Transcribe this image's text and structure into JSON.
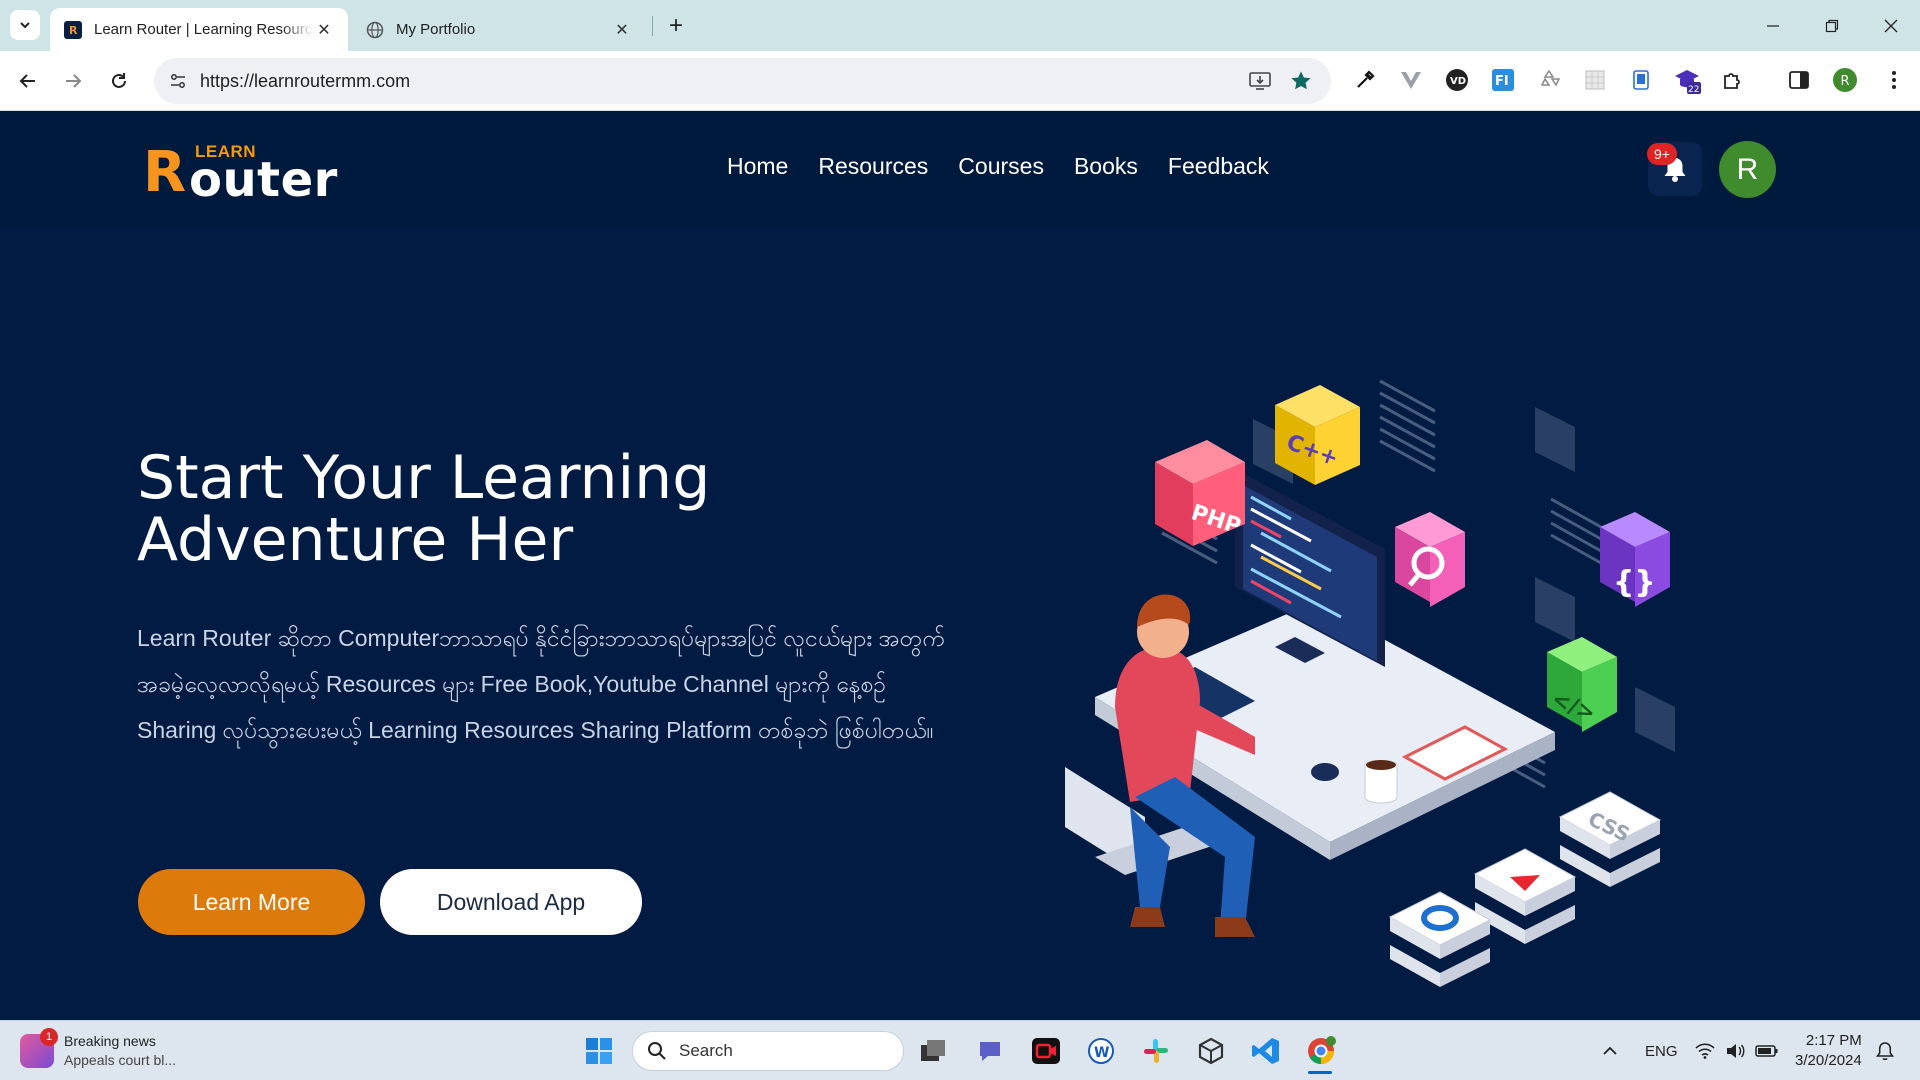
{
  "browser": {
    "tabs": [
      {
        "title": "Learn Router | Learning Resources",
        "active": true
      },
      {
        "title": "My Portfolio",
        "active": false
      }
    ],
    "url": "https://learnroutermm.com",
    "extension_badge": "22",
    "profile_initial": "R"
  },
  "site": {
    "logo_small": "LEARN",
    "logo_r": "R",
    "logo_rest": "outer",
    "nav": [
      "Home",
      "Resources",
      "Courses",
      "Books",
      "Feedback"
    ],
    "notification_badge": "9+",
    "avatar_initial": "R"
  },
  "hero": {
    "title": "Start Your Learning Adventure Her",
    "description": "Learn Router ဆိုတာ Computerဘာသာရပ် နိုင်ငံခြားဘာသာရပ်များအပြင် လူငယ်များ အတွက် အခမဲ့လေ့လာလိုရမယ့် Resources များ Free Book,Youtube Channel များကို နေ့စဉ် Sharing လုပ်သွားပေးမယ့် Learning Resources Sharing Platform တစ်ခုဘဲ ဖြစ်ပါတယ်။",
    "primary_button": "Learn More",
    "secondary_button": "Download App",
    "illustration_labels": [
      "PHP",
      "C++",
      "CSS"
    ]
  },
  "taskbar": {
    "news_badge": "1",
    "news_title": "Breaking news",
    "news_subtitle": "Appeals court bl...",
    "search_label": "Search",
    "lang": "ENG",
    "time": "2:17 PM",
    "date": "3/20/2024"
  },
  "colors": {
    "page_bg": "#021b42",
    "header_bg": "#001a3d",
    "accent_orange": "#dd7a0c",
    "avatar_green": "#3f8b2e"
  }
}
